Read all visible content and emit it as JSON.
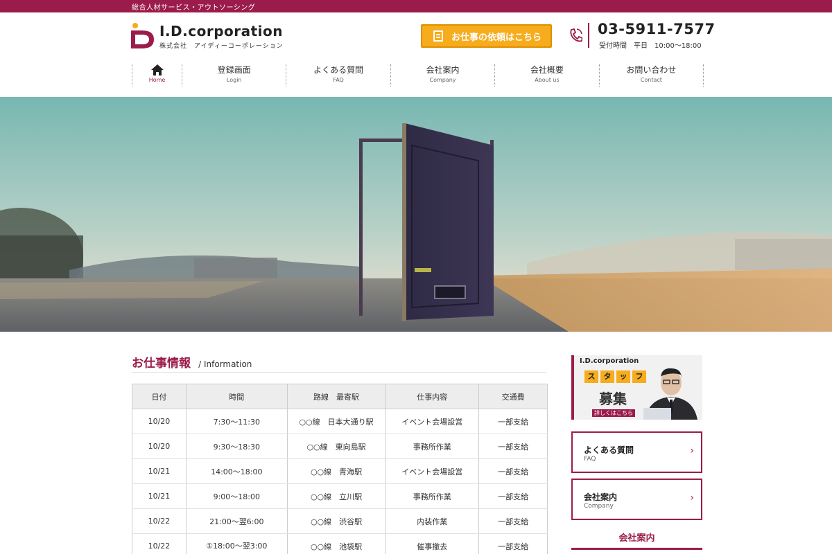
{
  "topbar": {
    "tagline": "総合人材サービス・アウトソーシング"
  },
  "header": {
    "logo_name": "I.D.corporation",
    "logo_sub": "株式会社　アイディーコーポレーション",
    "request_button": "お仕事の依頼はこちら",
    "phone": "03-5911-7577",
    "hours": "受付時間　平日　10:00〜18:00"
  },
  "nav": {
    "home": {
      "en": "Home"
    },
    "items": [
      {
        "jp": "登録画面",
        "en": "Login"
      },
      {
        "jp": "よくある質問",
        "en": "FAQ"
      },
      {
        "jp": "会社案内",
        "en": "Company"
      },
      {
        "jp": "会社概要",
        "en": "About us"
      },
      {
        "jp": "お問い合わせ",
        "en": "Contact"
      }
    ]
  },
  "jobs": {
    "title": "お仕事情報",
    "title_en": "/ Information",
    "headers": {
      "date": "日付",
      "time": "時間",
      "line": "路線　最寄駅",
      "work": "仕事内容",
      "fare": "交通費"
    },
    "rows": [
      {
        "date": "10/20",
        "time": "7:30〜11:30",
        "line": "○○線　日本大通り駅",
        "work": "イベント会場設営",
        "fare": "一部支給"
      },
      {
        "date": "10/20",
        "time": "9:30〜18:30",
        "line": "○○線　東向島駅",
        "work": "事務所作業",
        "fare": "一部支給"
      },
      {
        "date": "10/21",
        "time": "14:00〜18:00",
        "line": "○○線　青海駅",
        "work": "イベント会場設営",
        "fare": "一部支給"
      },
      {
        "date": "10/21",
        "time": "9:00〜18:00",
        "line": "○○線　立川駅",
        "work": "事務所作業",
        "fare": "一部支給"
      },
      {
        "date": "10/22",
        "time": "21:00〜翌6:00",
        "line": "○○線　渋谷駅",
        "work": "内装作業",
        "fare": "一部支給"
      },
      {
        "date": "10/22",
        "time": "①18:00〜翌3:00",
        "line": "○○線　池袋駅",
        "work": "催事撤去",
        "fare": "一部支給"
      }
    ]
  },
  "sidebar": {
    "banner": {
      "brand": "I.D.corporation",
      "tiles": [
        "ス",
        "タ",
        "ッ",
        "フ"
      ],
      "heading": "募集",
      "more": "詳しくはこちら"
    },
    "links": [
      {
        "jp": "よくある質問",
        "en": "FAQ",
        "chevron": "›"
      },
      {
        "jp": "会社案内",
        "en": "Company",
        "chevron": "›"
      }
    ],
    "heading": "会社案内"
  },
  "colors": {
    "brand": "#9b1c4a",
    "accent": "#f6ac1d"
  }
}
